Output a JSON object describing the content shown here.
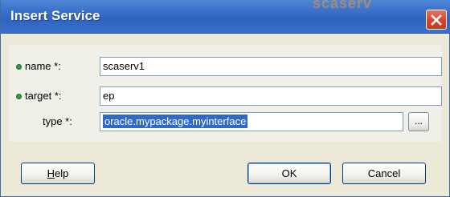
{
  "window": {
    "title": "Insert Service",
    "ghost_text": "scaserv"
  },
  "form": {
    "name_label": "name *:",
    "name_value": "scaserv1",
    "target_label": "target *:",
    "target_value": "ep",
    "type_label": "type *:",
    "type_value": "oracle.mypackage.myinterface",
    "browse_label": "..."
  },
  "buttons": {
    "help_prefix": "H",
    "help_rest": "elp",
    "ok": "OK",
    "cancel": "Cancel"
  },
  "icons": {
    "close": "close-icon",
    "required": "required-indicator-icon"
  },
  "colors": {
    "titlebar": "#3b6fc8",
    "close": "#d6452b",
    "selection": "#316ac5",
    "required_bullet": "#2f9e3c"
  }
}
